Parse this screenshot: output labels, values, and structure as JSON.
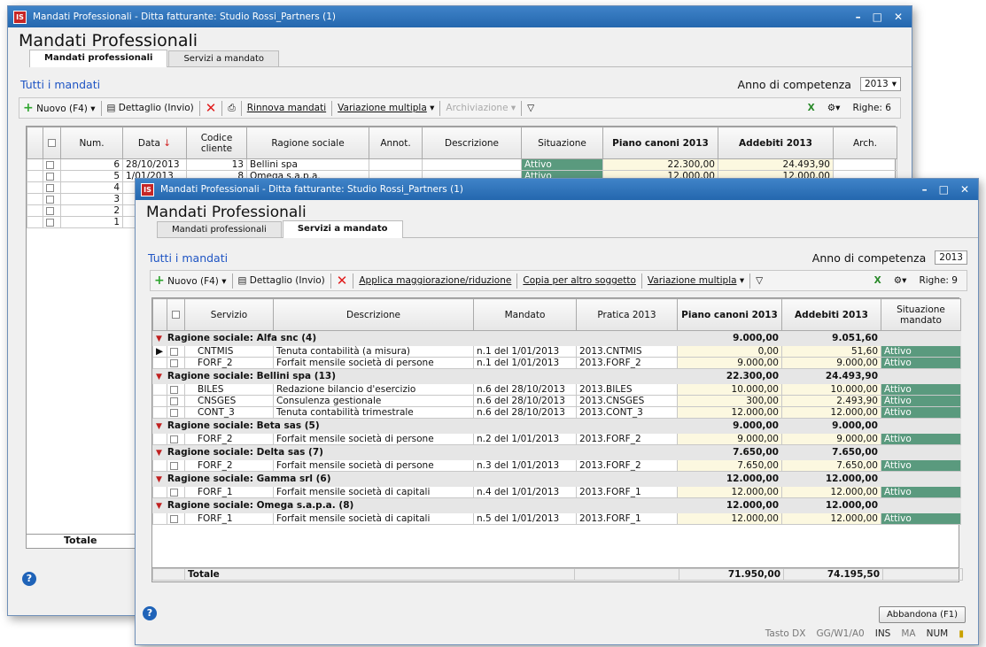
{
  "back": {
    "title": "Mandati Professionali - Ditta fatturante: Studio Rossi_Partners (1)",
    "heading": "Mandati Professionali",
    "tabs": [
      "Mandati professionali",
      "Servizi a mandato"
    ],
    "section": "Tutti i mandati",
    "anno_label": "Anno di competenza",
    "anno": "2013",
    "toolbar": {
      "nuovo": "Nuovo (F4)",
      "dettaglio": "Dettaglio (Invio)",
      "rinnova": "Rinnova mandati",
      "variazione": "Variazione multipla",
      "archiviazione": "Archiviazione",
      "righe": "Righe: 6"
    },
    "cols": [
      "Num.",
      "Data",
      "Codice cliente",
      "Ragione sociale",
      "Annot.",
      "Descrizione",
      "Situazione",
      "Piano canoni 2013",
      "Addebiti 2013",
      "Arch."
    ],
    "rows": [
      {
        "num": "6",
        "data": "28/10/2013",
        "cod": "13",
        "rag": "Bellini spa",
        "sit": "Attivo",
        "piano": "22.300,00",
        "add": "24.493,90"
      },
      {
        "num": "5",
        "data": "1/01/2013",
        "cod": "8",
        "rag": "Omega s.a.p.a.",
        "sit": "Attivo",
        "piano": "12.000,00",
        "add": "12.000,00"
      },
      {
        "num": "4",
        "data": "",
        "cod": "",
        "rag": "",
        "sit": "",
        "piano": "",
        "add": ""
      },
      {
        "num": "3",
        "data": "",
        "cod": "",
        "rag": "",
        "sit": "",
        "piano": "",
        "add": ""
      },
      {
        "num": "2",
        "data": "",
        "cod": "",
        "rag": "",
        "sit": "",
        "piano": "",
        "add": ""
      },
      {
        "num": "1",
        "data": "",
        "cod": "",
        "rag": "",
        "sit": "",
        "piano": "",
        "add": ""
      }
    ],
    "totale": "Totale"
  },
  "front": {
    "title": "Mandati Professionali - Ditta fatturante: Studio Rossi_Partners (1)",
    "heading": "Mandati Professionali",
    "tabs": [
      "Mandati professionali",
      "Servizi a mandato"
    ],
    "section": "Tutti i mandati",
    "anno_label": "Anno di competenza",
    "anno": "2013",
    "toolbar": {
      "nuovo": "Nuovo (F4)",
      "dettaglio": "Dettaglio (Invio)",
      "applica": "Applica maggiorazione/riduzione",
      "copia": "Copia per altro soggetto",
      "variazione": "Variazione multipla",
      "righe": "Righe: 9"
    },
    "cols": [
      "Servizio",
      "Descrizione",
      "Mandato",
      "Pratica 2013",
      "Piano canoni 2013",
      "Addebiti 2013",
      "Situazione mandato"
    ],
    "groups": [
      {
        "label": "Ragione sociale: Alfa snc  (4)",
        "piano": "9.000,00",
        "add": "9.051,60",
        "rows": [
          {
            "s": "CNTMIS",
            "d": "Tenuta contabilità (a misura)",
            "m": "n.1 del 1/01/2013",
            "p": "2013.CNTMIS",
            "pc": "0,00",
            "a": "51,60",
            "st": "Attivo"
          },
          {
            "s": "FORF_2",
            "d": "Forfait mensile società di persone",
            "m": "n.1 del 1/01/2013",
            "p": "2013.FORF_2",
            "pc": "9.000,00",
            "a": "9.000,00",
            "st": "Attivo"
          }
        ]
      },
      {
        "label": "Ragione sociale: Bellini spa  (13)",
        "piano": "22.300,00",
        "add": "24.493,90",
        "rows": [
          {
            "s": "BILES",
            "d": "Redazione bilancio d'esercizio",
            "m": "n.6 del 28/10/2013",
            "p": "2013.BILES",
            "pc": "10.000,00",
            "a": "10.000,00",
            "st": "Attivo"
          },
          {
            "s": "CNSGES",
            "d": "Consulenza gestionale",
            "m": "n.6 del 28/10/2013",
            "p": "2013.CNSGES",
            "pc": "300,00",
            "a": "2.493,90",
            "st": "Attivo"
          },
          {
            "s": "CONT_3",
            "d": "Tenuta contabilità trimestrale",
            "m": "n.6 del 28/10/2013",
            "p": "2013.CONT_3",
            "pc": "12.000,00",
            "a": "12.000,00",
            "st": "Attivo"
          }
        ]
      },
      {
        "label": "Ragione sociale: Beta sas  (5)",
        "piano": "9.000,00",
        "add": "9.000,00",
        "rows": [
          {
            "s": "FORF_2",
            "d": "Forfait mensile società di persone",
            "m": "n.2 del 1/01/2013",
            "p": "2013.FORF_2",
            "pc": "9.000,00",
            "a": "9.000,00",
            "st": "Attivo"
          }
        ]
      },
      {
        "label": "Ragione sociale: Delta sas  (7)",
        "piano": "7.650,00",
        "add": "7.650,00",
        "rows": [
          {
            "s": "FORF_2",
            "d": "Forfait mensile società di persone",
            "m": "n.3 del 1/01/2013",
            "p": "2013.FORF_2",
            "pc": "7.650,00",
            "a": "7.650,00",
            "st": "Attivo"
          }
        ]
      },
      {
        "label": "Ragione sociale: Gamma srl  (6)",
        "piano": "12.000,00",
        "add": "12.000,00",
        "rows": [
          {
            "s": "FORF_1",
            "d": "Forfait mensile società di capitali",
            "m": "n.4 del 1/01/2013",
            "p": "2013.FORF_1",
            "pc": "12.000,00",
            "a": "12.000,00",
            "st": "Attivo"
          }
        ]
      },
      {
        "label": "Ragione sociale: Omega s.a.p.a.  (8)",
        "piano": "12.000,00",
        "add": "12.000,00",
        "rows": [
          {
            "s": "FORF_1",
            "d": "Forfait mensile società di capitali",
            "m": "n.5 del 1/01/2013",
            "p": "2013.FORF_1",
            "pc": "12.000,00",
            "a": "12.000,00",
            "st": "Attivo"
          }
        ]
      }
    ],
    "totale": {
      "label": "Totale",
      "piano": "71.950,00",
      "add": "74.195,50"
    },
    "abbandona": "Abbandona (F1)",
    "status": {
      "tasto": "Tasto DX",
      "gg": "GG/W1/A0",
      "ins": "INS",
      "ma": "MA",
      "num": "NUM"
    }
  }
}
